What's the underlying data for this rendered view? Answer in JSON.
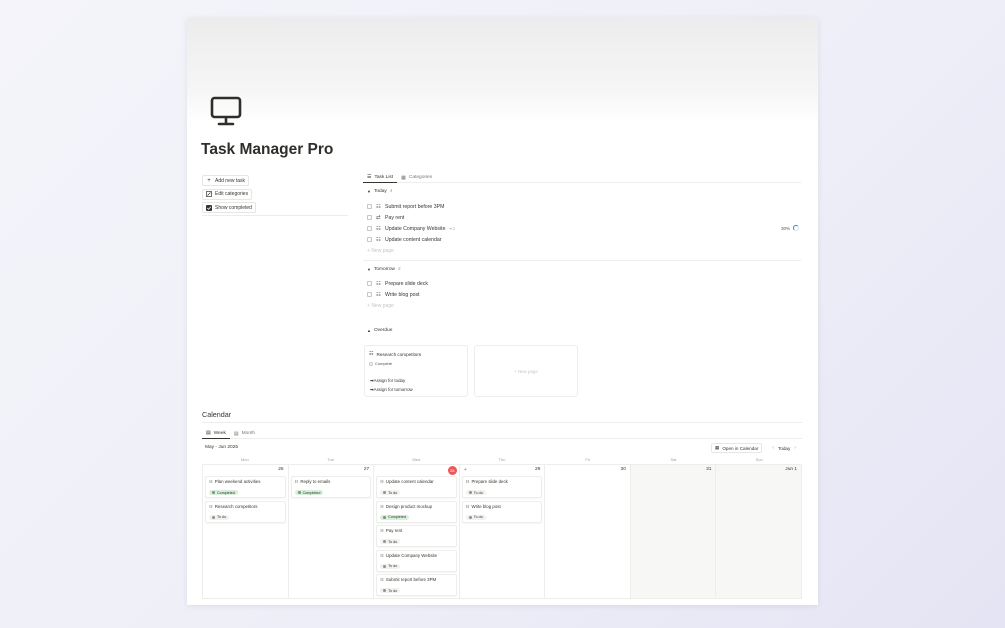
{
  "page": {
    "title": "Task Manager Pro",
    "icon": "desktop-computer-icon"
  },
  "sidebar": {
    "buttons": [
      {
        "label": "Add new task",
        "icon": "plus-icon"
      },
      {
        "label": "Edit categories",
        "icon": "edit-icon"
      },
      {
        "label": "Show completed",
        "icon": "checkbox-icon"
      }
    ]
  },
  "tabs": [
    {
      "label": "Task List",
      "icon": "list-icon",
      "active": true
    },
    {
      "label": "Categories",
      "icon": "table-icon",
      "active": false
    }
  ],
  "groups": {
    "today": {
      "label": "Today",
      "count": "4",
      "tasks": [
        {
          "label": "Submit report before 3PM",
          "icon": "checklist-icon"
        },
        {
          "label": "Pay rent",
          "icon": "repeat-icon"
        },
        {
          "label": "Update Company Website",
          "icon": "checklist-icon",
          "extra": "⇥ 2"
        },
        {
          "label": "Update content calendar",
          "icon": "checklist-icon"
        }
      ],
      "new_page": "New page",
      "progress": "30%"
    },
    "tomorrow": {
      "label": "Tomorrow",
      "count": "2",
      "tasks": [
        {
          "label": "Prepare slide deck",
          "icon": "checklist-icon"
        },
        {
          "label": "Write blog post",
          "icon": "checklist-icon"
        }
      ],
      "new_page": "New page"
    },
    "overdue": {
      "label": "Overdue",
      "cards": [
        {
          "title": "Research competitors",
          "status": "Complete",
          "buttons": [
            "➡Assign for today",
            "➡Assign for tomorrow"
          ]
        }
      ],
      "new_page": "New page"
    }
  },
  "calendar": {
    "title": "Calendar",
    "views": [
      {
        "label": "Week",
        "active": true
      },
      {
        "label": "Month",
        "active": false
      }
    ],
    "range": "May - Jun 2025",
    "open_in_calendar": "Open in Calendar",
    "today_label": "Today",
    "weekdays": [
      "Mon",
      "Tue",
      "Wed",
      "Thu",
      "Fri",
      "Sat",
      "Sun"
    ],
    "days": [
      {
        "num": "26",
        "events": [
          {
            "title": "Plan weekend activities",
            "status": "Completed"
          },
          {
            "title": "Research competitors",
            "status": "To do"
          }
        ]
      },
      {
        "num": "27",
        "events": [
          {
            "title": "Reply to emails",
            "status": "Completed"
          }
        ]
      },
      {
        "num": "28",
        "today": true,
        "events": [
          {
            "title": "Update content calendar",
            "status": "To do"
          },
          {
            "title": "Design product mockup",
            "status": "Completed"
          },
          {
            "title": "Pay rent",
            "status": "To do"
          },
          {
            "title": "Update Company Website",
            "status": "To do"
          },
          {
            "title": "Submit report before 3PM",
            "status": "To do"
          }
        ]
      },
      {
        "num": "29",
        "add": "+",
        "events": [
          {
            "title": "Prepare slide deck",
            "status": "To do"
          },
          {
            "title": "Write blog post",
            "status": "To do"
          }
        ]
      },
      {
        "num": "30",
        "events": []
      },
      {
        "num": "31",
        "weekend": true,
        "events": []
      },
      {
        "num": "Jun 1",
        "weekend": true,
        "events": []
      }
    ]
  },
  "colors": {
    "accent_red": "#eb5757",
    "completed_bg": "#dbeddb",
    "todo_bg": "#f1f1ef",
    "progress_blue": "#2383e2"
  }
}
